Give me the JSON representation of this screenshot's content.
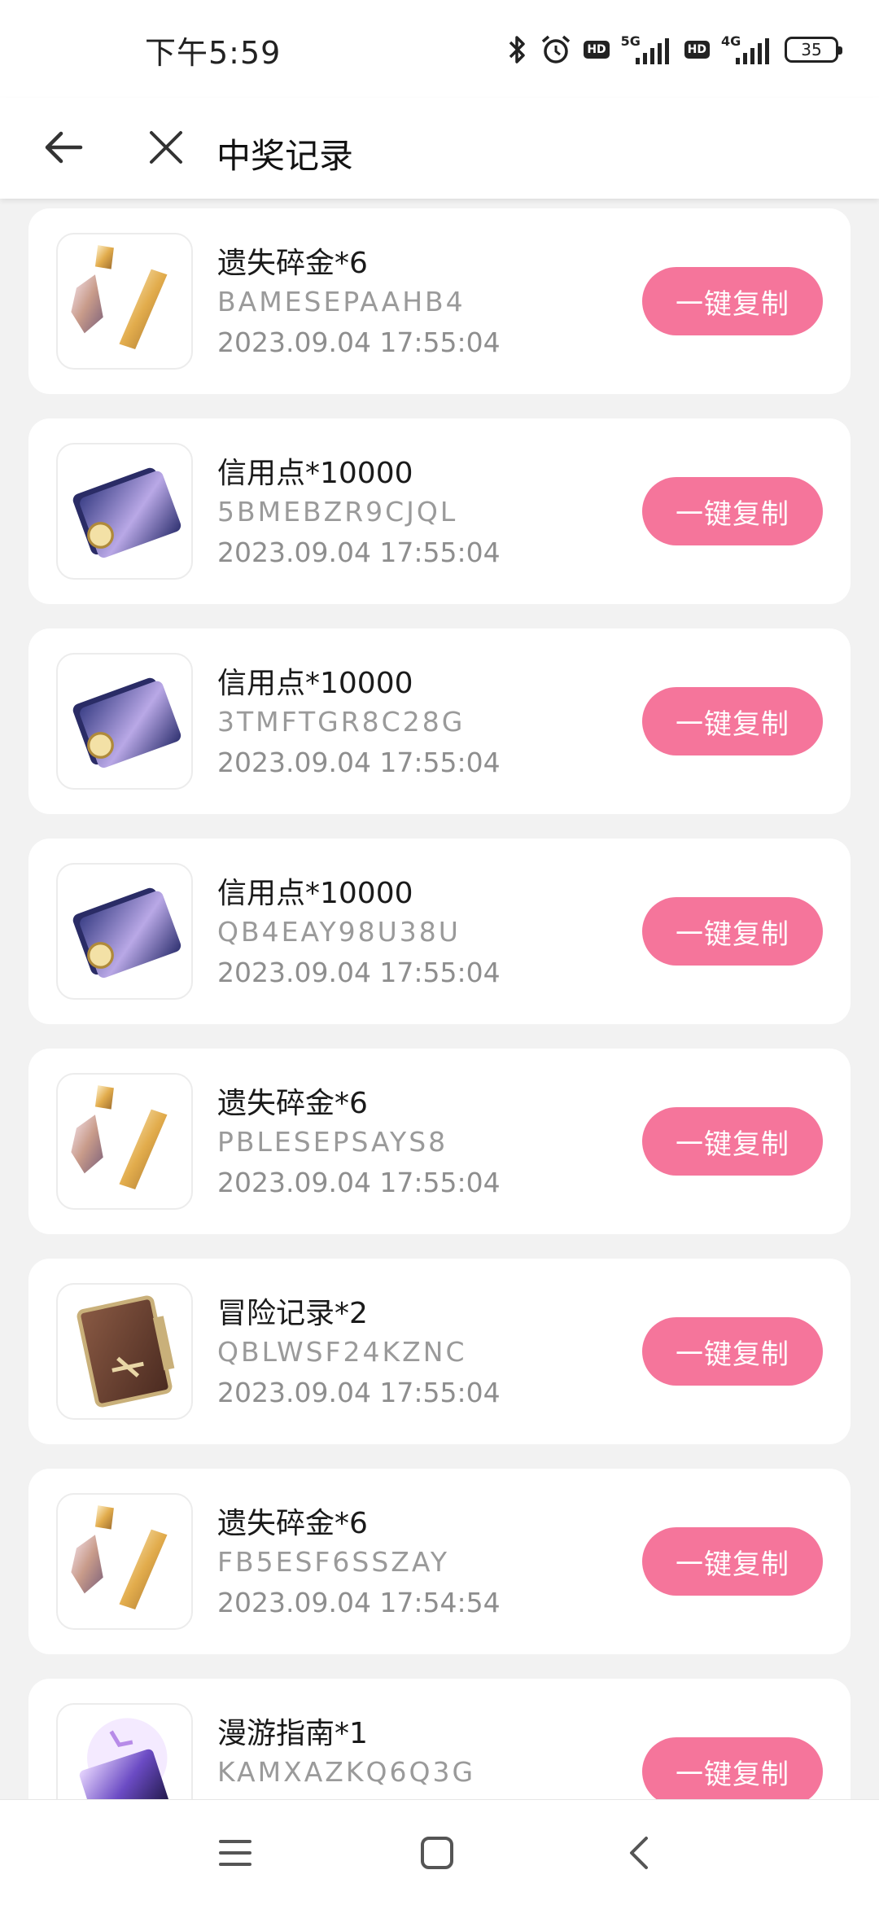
{
  "status_bar": {
    "time": "下午5:59",
    "network_1": "5G",
    "network_2": "4G",
    "hd_label": "HD",
    "battery": "35"
  },
  "header": {
    "title": "中奖记录"
  },
  "colors": {
    "accent": "#f5759b",
    "background": "#f2f2f2"
  },
  "records": [
    {
      "name": "遗失碎金*6",
      "code": "BAMESEPAAHB4",
      "time": "2023.09.04 17:55:04",
      "icon": "gold-fragment-icon",
      "button": "一键复制"
    },
    {
      "name": "信用点*10000",
      "code": "5BMEBZR9CJQL",
      "time": "2023.09.04 17:55:04",
      "icon": "credit-card-icon",
      "button": "一键复制"
    },
    {
      "name": "信用点*10000",
      "code": "3TMFTGR8C28G",
      "time": "2023.09.04 17:55:04",
      "icon": "credit-card-icon",
      "button": "一键复制"
    },
    {
      "name": "信用点*10000",
      "code": "QB4EAY98U38U",
      "time": "2023.09.04 17:55:04",
      "icon": "credit-card-icon",
      "button": "一键复制"
    },
    {
      "name": "遗失碎金*6",
      "code": "PBLESEPSAYS8",
      "time": "2023.09.04 17:55:04",
      "icon": "gold-fragment-icon",
      "button": "一键复制"
    },
    {
      "name": "冒险记录*2",
      "code": "QBLWSF24KZNC",
      "time": "2023.09.04 17:55:04",
      "icon": "adventure-book-icon",
      "button": "一键复制"
    },
    {
      "name": "遗失碎金*6",
      "code": "FB5ESF6SSZAY",
      "time": "2023.09.04 17:54:54",
      "icon": "gold-fragment-icon",
      "button": "一键复制"
    },
    {
      "name": "漫游指南*1",
      "code": "KAMXAZKQ6Q3G",
      "time": "",
      "icon": "guide-book-icon",
      "button": "一键复制"
    }
  ]
}
